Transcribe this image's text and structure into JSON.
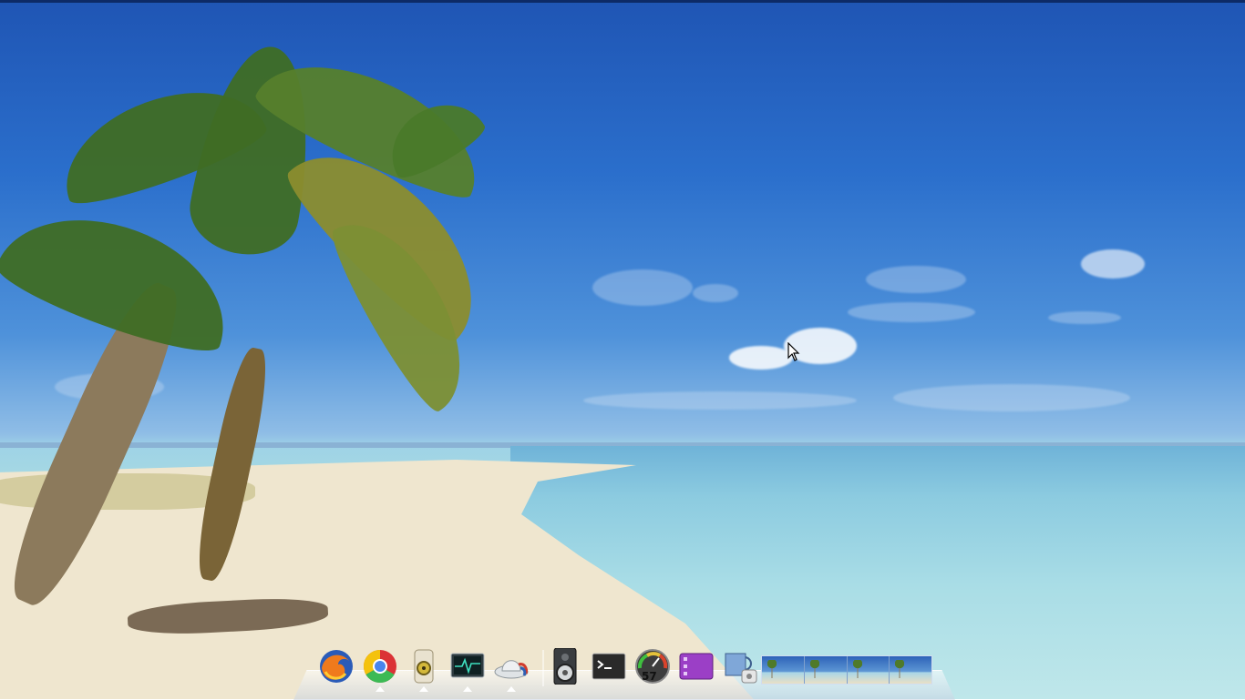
{
  "desktop": {
    "wallpaper": "tropical-beach-palm",
    "colors": {
      "sky": "#2b6fcc",
      "sea": "#a9dde6",
      "sand": "#efe6cf"
    }
  },
  "dock": {
    "items": [
      {
        "name": "firefox",
        "icon": "firefox-icon",
        "running": false
      },
      {
        "name": "chrome",
        "icon": "chrome-icon",
        "running": true
      },
      {
        "name": "audio-player",
        "icon": "speaker-app-icon",
        "running": true
      },
      {
        "name": "system-monitor",
        "icon": "system-monitor-icon",
        "running": true
      },
      {
        "name": "hat-app",
        "icon": "hat-icon",
        "running": true
      },
      {
        "name": "volume",
        "icon": "speaker-icon",
        "running": false
      },
      {
        "name": "terminal",
        "icon": "terminal-icon",
        "running": false
      },
      {
        "name": "cpu-monitor",
        "icon": "gauge-icon",
        "running": false,
        "badge": "57"
      },
      {
        "name": "media-app",
        "icon": "purple-app-icon",
        "running": false
      },
      {
        "name": "network-app",
        "icon": "network-icon",
        "running": false
      }
    ],
    "workspace_count": 4
  }
}
